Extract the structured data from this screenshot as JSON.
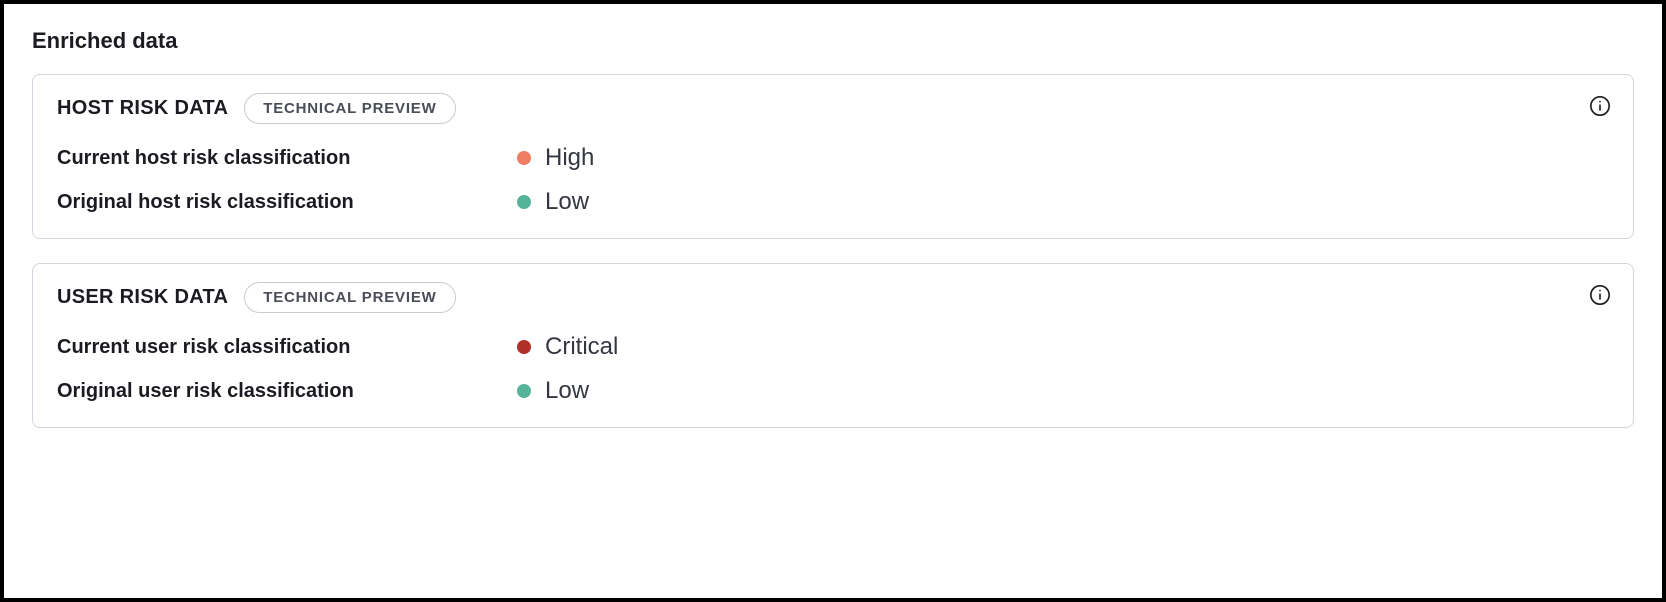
{
  "section_title": "Enriched data",
  "colors": {
    "high": "#ee7d64",
    "low": "#55b399",
    "critical": "#b03028"
  },
  "panels": [
    {
      "title": "HOST RISK DATA",
      "badge": "TECHNICAL PREVIEW",
      "rows": [
        {
          "label": "Current host risk classification",
          "value": "High",
          "color_key": "high"
        },
        {
          "label": "Original host risk classification",
          "value": "Low",
          "color_key": "low"
        }
      ]
    },
    {
      "title": "USER RISK DATA",
      "badge": "TECHNICAL PREVIEW",
      "rows": [
        {
          "label": "Current user risk classification",
          "value": "Critical",
          "color_key": "critical"
        },
        {
          "label": "Original user risk classification",
          "value": "Low",
          "color_key": "low"
        }
      ]
    }
  ]
}
